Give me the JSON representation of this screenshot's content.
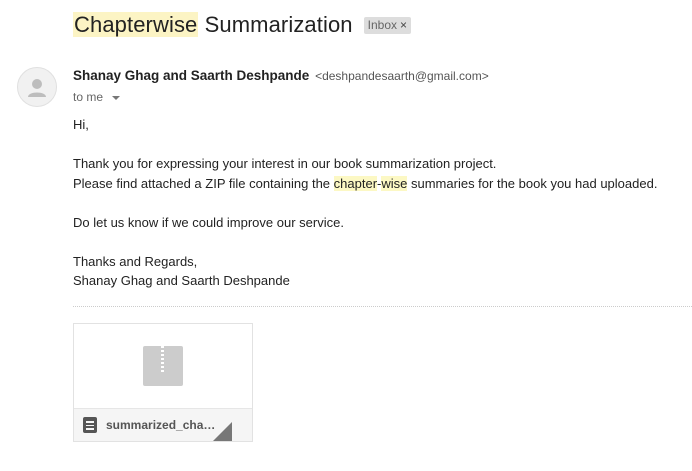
{
  "subject": {
    "title_highlight": "Chapterwise",
    "title_rest": "Summarization",
    "label": "Inbox",
    "label_remove": "×"
  },
  "sender": {
    "name": "Shanay Ghag and Saarth Deshpande",
    "email": "<deshpandesaarth@gmail.com>",
    "to": "to me",
    "avatar_icon": "person-icon"
  },
  "body": {
    "greeting": "Hi,",
    "line1": "Thank you for expressing your interest in our book summarization project.",
    "line2_pre": "Please find attached a ZIP file containing the ",
    "line2_hl1": "chapter",
    "line2_dash": "-",
    "line2_hl2": "wise",
    "line2_post": " summaries for the book you had uploaded.",
    "line3": "Do let us know if we could improve our service.",
    "closing": "Thanks and Regards,",
    "signature": "Shanay Ghag and Saarth Deshpande"
  },
  "attachment": {
    "file_name": "summarized_chapt…",
    "thumb_icon": "zip-file-icon",
    "type_icon": "document-icon"
  },
  "colors": {
    "highlight": "#fcf4c4",
    "chip_bg": "#dddddd",
    "zip_gray": "#cccccc"
  }
}
